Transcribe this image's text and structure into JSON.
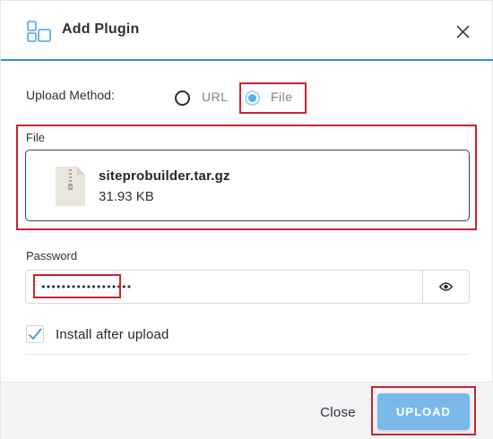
{
  "dialog": {
    "title": "Add Plugin",
    "title_icon": "plugin-blocks-icon",
    "close_icon": "close-icon",
    "accent_color": "#2f8fe0"
  },
  "upload_method": {
    "label": "Upload Method:",
    "options": [
      {
        "label": "URL",
        "selected": false
      },
      {
        "label": "File",
        "selected": true
      }
    ]
  },
  "file": {
    "label": "File",
    "icon": "archive-file-icon",
    "name": "siteprobuilder.tar.gz",
    "size": "31.93 KB"
  },
  "password": {
    "label": "Password",
    "value": "••••••••••••••••••",
    "toggle_icon": "eye-icon"
  },
  "install_after_upload": {
    "label": "Install after upload",
    "checked": true
  },
  "footer": {
    "close_label": "Close",
    "upload_label": "UPLOAD",
    "upload_color": "#7ab8ec"
  },
  "highlight_color": "#c9242f"
}
